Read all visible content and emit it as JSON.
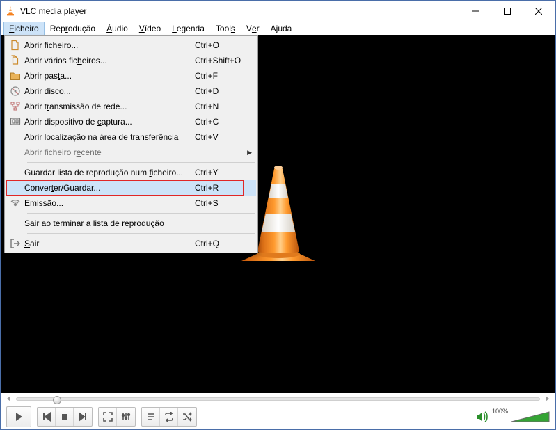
{
  "window": {
    "title": "VLC media player"
  },
  "menubar": {
    "items": [
      {
        "html": "<span class='mn'>F</span>icheiro",
        "open": true
      },
      {
        "html": "Rep<span class='mn'>r</span>odução"
      },
      {
        "html": "<span class='mn'>Á</span>udio"
      },
      {
        "html": "<span class='mn'>V</span>ídeo"
      },
      {
        "html": "<span class='mn'>L</span>egenda"
      },
      {
        "html": "Tool<span class='mn'>s</span>"
      },
      {
        "html": "V<span class='mn'>e</span>r"
      },
      {
        "html": "A<span class='mn'>j</span>uda"
      }
    ]
  },
  "dropdown": {
    "items": [
      {
        "icon": "file",
        "html": "Abrir <span class='mn'>f</span>icheiro...",
        "shortcut": "Ctrl+O"
      },
      {
        "icon": "files",
        "html": "Abrir vários fic<span class='mn'>h</span>eiros...",
        "shortcut": "Ctrl+Shift+O"
      },
      {
        "icon": "folder",
        "html": "Abrir pas<span class='mn'>t</span>a...",
        "shortcut": "Ctrl+F"
      },
      {
        "icon": "disc",
        "html": "Abrir <span class='mn'>d</span>isco...",
        "shortcut": "Ctrl+D"
      },
      {
        "icon": "network",
        "html": "Abrir t<span class='mn'>r</span>ansmissão de rede...",
        "shortcut": "Ctrl+N"
      },
      {
        "icon": "capture",
        "html": "Abrir dispositivo de <span class='mn'>c</span>aptura...",
        "shortcut": "Ctrl+C"
      },
      {
        "icon": "",
        "html": "Abrir <span class='mn'>l</span>ocalização na área de transferência",
        "shortcut": "Ctrl+V"
      },
      {
        "icon": "",
        "html": "Abrir ficheiro r<span class='mn'>e</span>cente",
        "disabled": true,
        "submenu": true
      },
      {
        "sep": true
      },
      {
        "icon": "",
        "html": "Guardar lista de reprodução num <span class='mn'>f</span>icheiro...",
        "shortcut": "Ctrl+Y"
      },
      {
        "icon": "",
        "html": "Conver<span class='mn'>t</span>er/Guardar...",
        "shortcut": "Ctrl+R",
        "hover": true,
        "ring": true
      },
      {
        "icon": "stream",
        "html": "Emi<span class='mn'>s</span>são...",
        "shortcut": "Ctrl+S"
      },
      {
        "sep": true
      },
      {
        "icon": "",
        "html": "Sair ao terminar a lista de reprodução"
      },
      {
        "sep": true
      },
      {
        "icon": "exit",
        "html": "<span class='mn'>S</span>air",
        "shortcut": "Ctrl+Q"
      }
    ]
  },
  "volume": {
    "label": "100%"
  }
}
